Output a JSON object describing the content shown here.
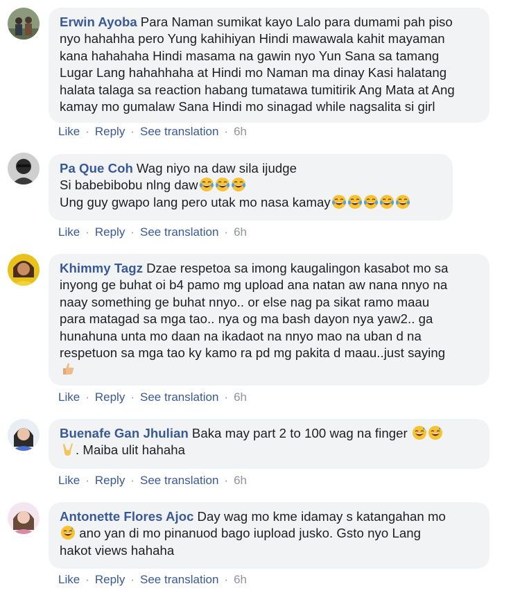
{
  "actions": {
    "like": "Like",
    "reply": "Reply",
    "see_translation": "See translation",
    "separator": "·"
  },
  "comments": [
    {
      "author": "Erwin Ayoba",
      "lines": [
        "Para Naman sumikat kayo Lalo para dumami pah piso",
        "nyo hahahha pero Yung kahihiyan Hindi mawawala kahit mayaman",
        "kana hahahaha Hindi masama na gawin nyo Yun Sana sa tamang",
        "Lugar Lang hahahhaha at Hindi mo Naman ma dinay Kasi halatang",
        "halata talaga sa reaction habang tumatawa tumitirik Ang Mata at Ang",
        "kamay mo gumalaw Sana Hindi mo sinagad while nagsalita si girl"
      ],
      "time": "6h",
      "avatar_icon": "group-photo-avatar-icon"
    },
    {
      "author": "Pa Que Coh",
      "lines": [
        "Wag niyo na daw sila ijudge",
        "Si babebibobu nlng daw",
        "Ung guy gwapo lang pero utak mo nasa kamay"
      ],
      "time": "6h",
      "avatar_icon": "dark-photo-avatar-icon",
      "emoji_icon": "tears-of-joy-emoji-icon"
    },
    {
      "author": "Khimmy Tagz",
      "lines": [
        "Dzae respetoa sa imong kaugalingon kasabot mo sa",
        "inyong ge buhat oi b4 pamo mg upload ana natan aw nana nnyo na",
        "naay something ge buhat nnyo.. or else nag pa sikat ramo maau",
        "para matagad sa mga tao.. nya og ma bash dayon nya yaw2.. ga",
        "hunahuna unta mo daan na ikadaot na nnyo mao na uban d na",
        "respetuon sa mga tao ky kamo ra pd mg pakita d maau..just saying"
      ],
      "time": "6h",
      "avatar_icon": "woman-yellow-avatar-icon",
      "emoji_icon": "thumbs-up-emoji-icon"
    },
    {
      "author": "Buenafe Gan Jhulian",
      "lines": [
        "Baka may part 2 to 100 wag na finger",
        ". Maiba ulit hahaha"
      ],
      "time": "6h",
      "avatar_icon": "woman-blue-avatar-icon",
      "emoji_icon": "grinning-sweat-emoji-icon",
      "emoji_icon_2": "victory-hand-emoji-icon"
    },
    {
      "author": "Antonette Flores Ajoc",
      "lines": [
        "Day wag mo kme idamay s katangahan mo",
        "ano yan di mo pinanuod bago iupload jusko. Gsto nyo Lang",
        "hakot views hahaha"
      ],
      "time": "6h",
      "avatar_icon": "woman-pink-avatar-icon",
      "emoji_icon": "grinning-sweat-emoji-icon"
    }
  ]
}
